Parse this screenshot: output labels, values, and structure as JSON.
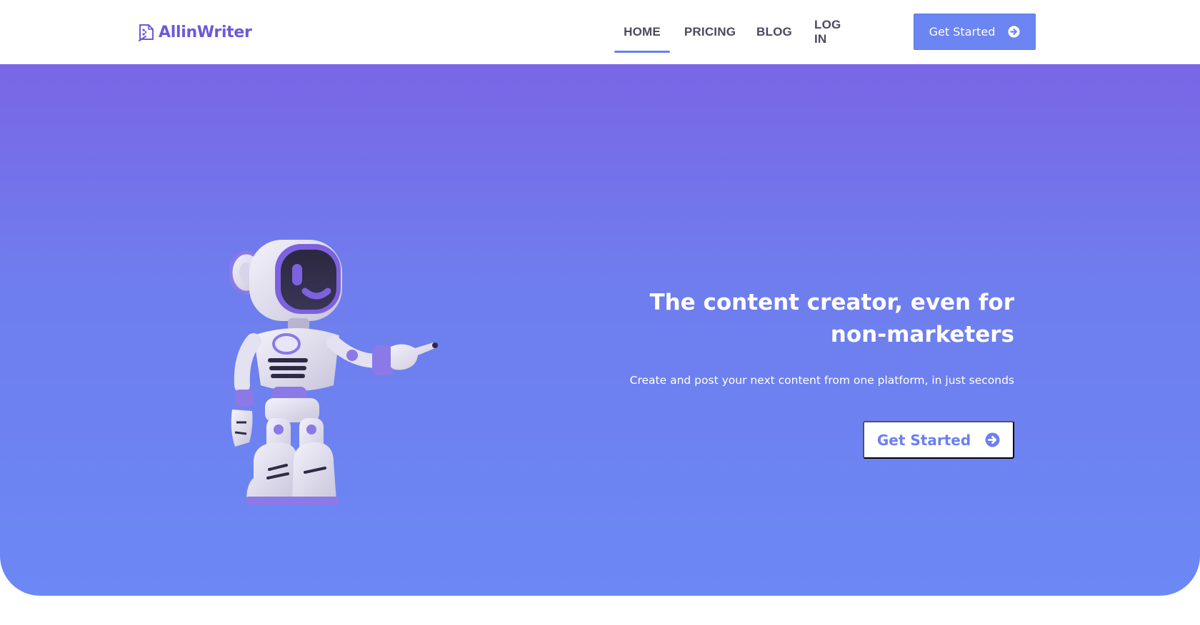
{
  "header": {
    "logo_text": "AllinWriter",
    "nav": [
      {
        "label": "HOME",
        "active": true
      },
      {
        "label": "PRICING",
        "active": false
      },
      {
        "label": "BLOG",
        "active": false
      },
      {
        "label": "LOG IN",
        "active": false
      }
    ],
    "cta_label": "Get Started"
  },
  "hero": {
    "title_line1": "The content creator, even for",
    "title_line2": "non-marketers",
    "subtitle": "Create and post your next content from one platform, in just seconds",
    "cta_label": "Get Started"
  },
  "icons": {
    "logo": "writer-logo-icon",
    "cta_arrow": "arrow-right-circle-icon",
    "hero_image": "robot-pointing-illustration"
  },
  "colors": {
    "brand_purple": "#6e58d9",
    "accent_blue": "#6b85f2",
    "hero_top": "#7a66e6",
    "hero_bottom": "#6b88f4",
    "nav_text": "#4a4a5c"
  }
}
